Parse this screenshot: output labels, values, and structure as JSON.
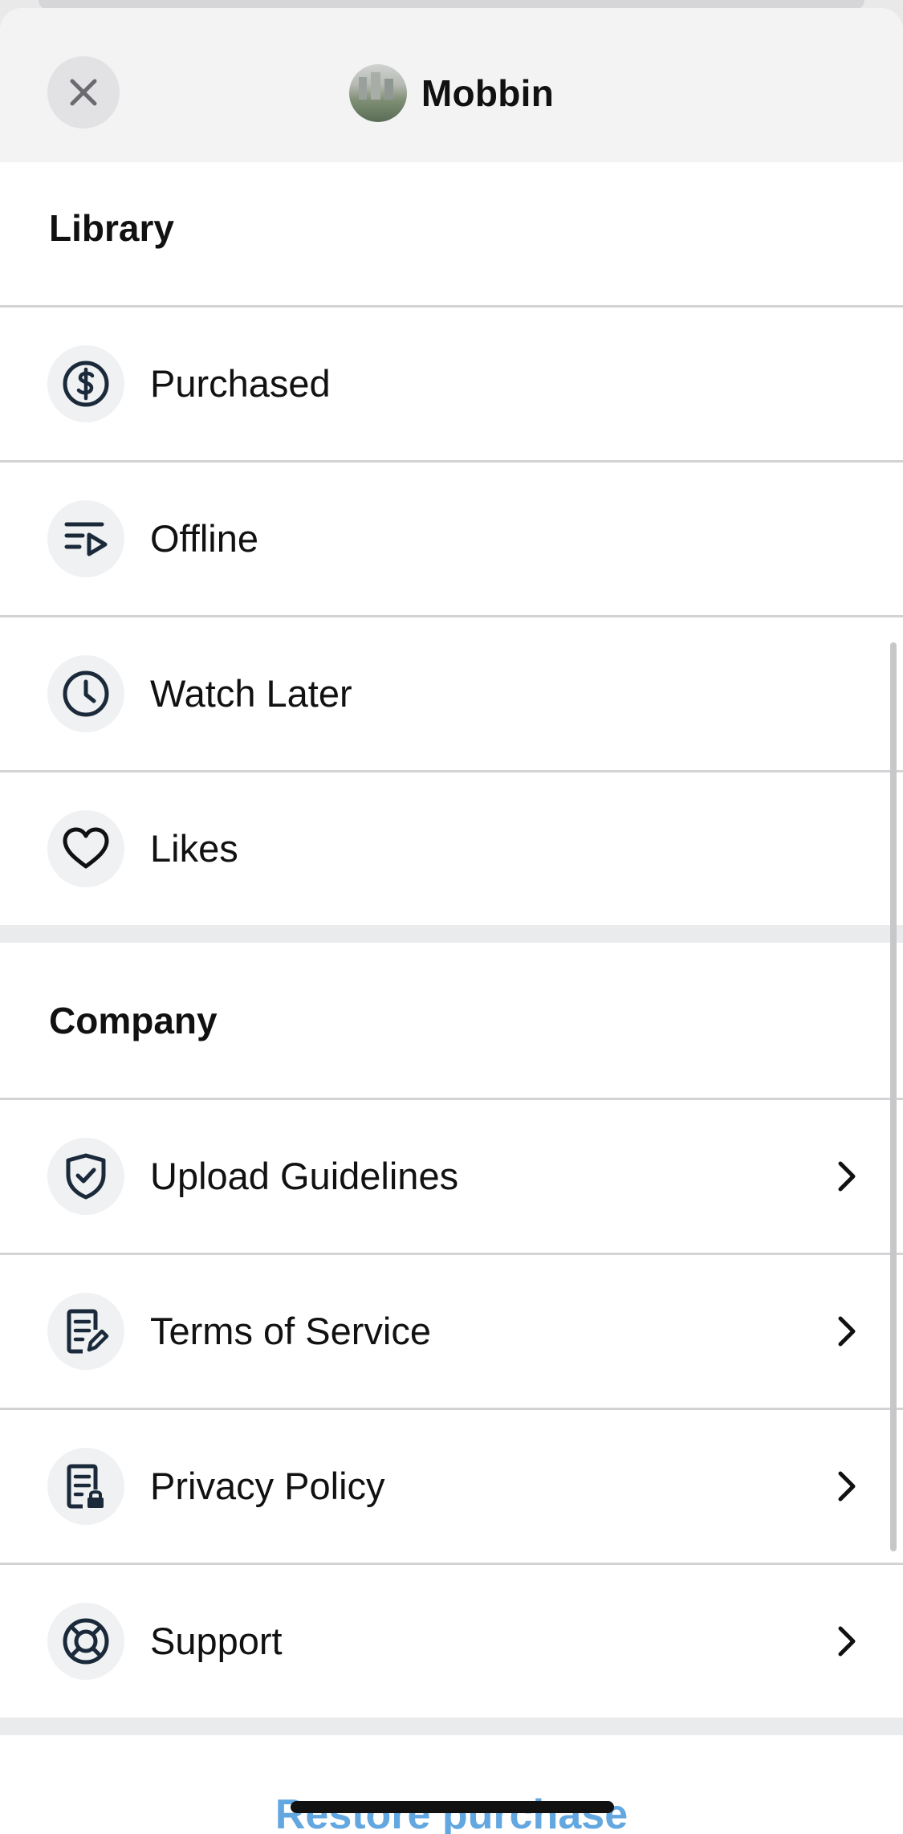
{
  "header": {
    "title": "Mobbin",
    "close_icon": "close-icon",
    "avatar": "app-avatar"
  },
  "library": {
    "title": "Library",
    "items": [
      {
        "label": "Purchased",
        "icon": "dollar-circle-icon"
      },
      {
        "label": "Offline",
        "icon": "playlist-play-icon"
      },
      {
        "label": "Watch Later",
        "icon": "clock-icon"
      },
      {
        "label": "Likes",
        "icon": "heart-icon"
      }
    ]
  },
  "company": {
    "title": "Company",
    "items": [
      {
        "label": "Upload Guidelines",
        "icon": "shield-check-icon"
      },
      {
        "label": "Terms of Service",
        "icon": "document-edit-icon"
      },
      {
        "label": "Privacy Policy",
        "icon": "document-lock-icon"
      },
      {
        "label": "Support",
        "icon": "lifebuoy-icon"
      }
    ]
  },
  "footer": {
    "restore_label": "Restore purchase"
  },
  "colors": {
    "icon": "#1b2a3a",
    "link": "#63a7e0",
    "divider": "#d3d3d5"
  }
}
